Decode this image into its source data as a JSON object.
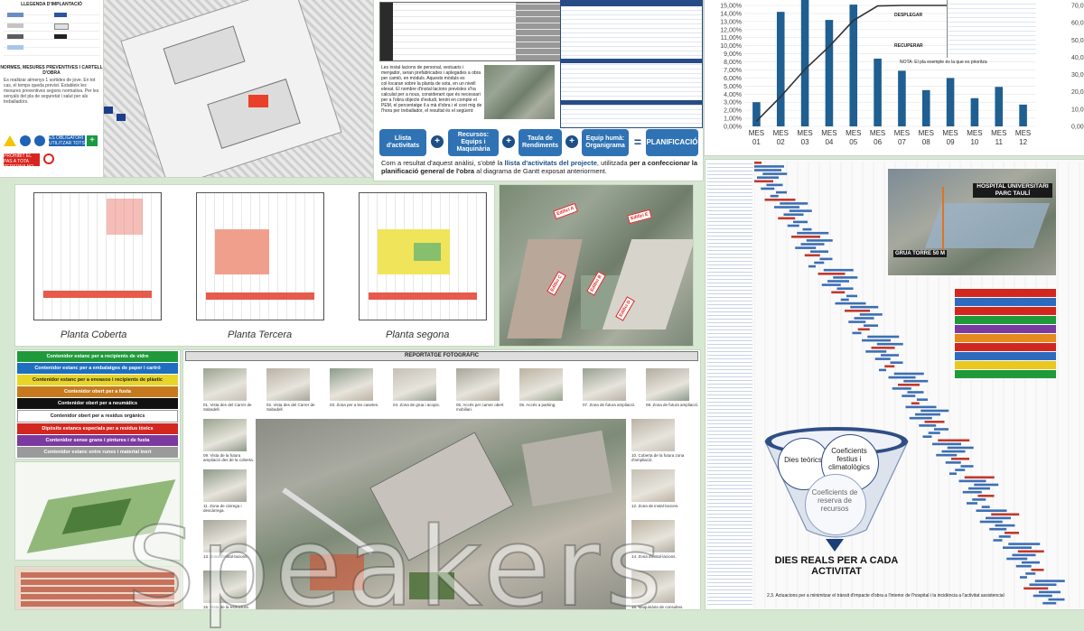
{
  "safety_panel": {
    "legend_title": "LLEGENDA D'IMPLANTACIÓ",
    "measures_title": "NORMES, MESURES PREVENTIVES I CARTELL D'OBRA",
    "body_text": "Es realitzar almenys 1 sortides de jove. En tot cas, el temps queda previst. Estableix les mesures preventives segons normativa. Per les senyals del pla de seguretat i salut per als treballadors.",
    "signs": [
      "ES OBLIGATORI UTILITZAR TOTS ELS EQUIPS DE PROTECCIÓ INDIVIDUAL",
      "PROHIBIT EL PAS A TOTA PERSONA NO AUTORITZADA"
    ]
  },
  "planning": {
    "text": "Les instal·lacions de personal, vestuaris i menjador, seran prefabricades i aplegades a obra per camió, en mòduls. Aquests mòduls es col·locaran sobre la planta de sota, en un nivell elevat. El nombre d'instal·lacions previstes s'ha calculat per a nous, considerant que és necessari per a l'obra objecte d'estudi, tenint en compte el PEM, el percentatge il a mà d'obra i el cost mig de l'hora per treballador, el resultat és el següent:",
    "flow": [
      {
        "label": "Llista d'activitats"
      },
      {
        "label": "Recursos: Equips i Maquinària"
      },
      {
        "label": "Taula de Rendiments"
      },
      {
        "label": "Equip humà: Organigrama"
      },
      {
        "label": "PLANIFICACIÓ"
      }
    ],
    "conclusion_start": "Com a resultat d'aquest anàlisi, s'obté la ",
    "conclusion_bold": "llista d'activitats del projecte",
    "conclusion_mid": ", utilitzada ",
    "conclusion_bold2": "per a confeccionar la planificació general de l'obra",
    "conclusion_end": " al diagrama de Gantt exposat anteriorment."
  },
  "plans": {
    "labels": [
      "Planta Coberta",
      "Planta Tercera",
      "Planta segona"
    ],
    "buildings": [
      "Edifici A",
      "Edifici B",
      "Edifici C",
      "Edifici D",
      "Edifici E"
    ]
  },
  "waste": {
    "rows": [
      {
        "label": "Contenidor estanc per a recipients de vidre",
        "color": "#1f9a3a"
      },
      {
        "label": "Contenidor estanc per a embalatges de paper i cartró",
        "color": "#1e6fc0"
      },
      {
        "label": "Contenidor estanc per a envasos i recipients de plàstic",
        "color": "#e9d52a"
      },
      {
        "label": "Contenidor obert per a fusta",
        "color": "#c77a1d"
      },
      {
        "label": "Contenidor obert per a neumàtics",
        "color": "#111111"
      },
      {
        "label": "Contenidor obert per a residus orgànics",
        "color": "#ffffff"
      },
      {
        "label": "Dipòsits estancs especials per a residus tòxics",
        "color": "#d2271f"
      },
      {
        "label": "Contenidor sense grans i pintures i de fusta",
        "color": "#7b3aa0"
      },
      {
        "label": "Contenidor estanc entre runes i material inert",
        "color": "#9a9a9a"
      }
    ]
  },
  "photo_report": {
    "title": "REPORTATGE FOTOGRÀFIC",
    "captions": [
      "01. Vista des del Carrer de Sabadell.",
      "02. Vista des del Carrer de Sabadell.",
      "03. Zona per a les casetes.",
      "04. Zona de grua i acopis.",
      "05. Accés per camer obert mobiliari.",
      "06. Accés a parking.",
      "07. Zona de futura ampliació.",
      "08. Zona de futura ampliació.",
      "09. Vista de la futura ampliació des de la coberta.",
      "10. Coberta de la futura zona d'ampliació.",
      "11. Zona de càrrega i descàrrega.",
      "12. Zona de instal·lacions.",
      "13. Zona d'instal·lacions.",
      "14. Zona d'instal·lacions.",
      "15. Vista de la estructura existent.",
      "16. Maquinària de consultes."
    ]
  },
  "chart": {
    "y_left_ticks": [
      "0,00%",
      "1,00%",
      "2,00%",
      "3,00%",
      "4,00%",
      "5,00%",
      "6,00%",
      "7,00%",
      "8,00%",
      "9,00%",
      "10,00%",
      "11,00%",
      "12,00%",
      "13,00%",
      "14,00%",
      "15,00%"
    ],
    "y_right_ticks": [
      "0,00%",
      "10,00%",
      "20,00%",
      "30,00%",
      "40,00%",
      "50,00%",
      "60,00%",
      "70,00%"
    ],
    "rec_labels": [
      "DESPLEGAR",
      "RECUPERAR"
    ],
    "legend_note": "NOTA: El pla exemple és la que es prioritza"
  },
  "chart_data": {
    "type": "bar",
    "categories": [
      "MES 01",
      "MES 02",
      "MES 03",
      "MES 04",
      "MES 05",
      "MES 06",
      "MES 07",
      "MES 08",
      "MES 09",
      "MES 10",
      "MES 11",
      "MES 12"
    ],
    "values": [
      3.0,
      14.2,
      15.8,
      13.2,
      15.1,
      8.4,
      6.9,
      4.5,
      6.0,
      3.5,
      4.9,
      2.7
    ],
    "cumulative": [
      3.0,
      17.2,
      33.0,
      46.2,
      61.3,
      69.7,
      76.6,
      81.1,
      87.1,
      90.6,
      95.5,
      98.2
    ],
    "ylim": [
      0,
      15
    ],
    "y2lim": [
      0,
      70
    ],
    "bar_color": "#1f5f91",
    "line_color": "#333333"
  },
  "gantt": {
    "hospital_label": "HOSPITAL UNIVERSITARI PARC TAULÍ",
    "crane_label": "GRUA TORRE 50 M",
    "funnel": [
      "Dies teòrics",
      "Coeficients festius i climatològics",
      "Coeficients de reserva de recursos"
    ],
    "result": "DIES REALS PER A CADA ACTIVITAT",
    "footer": "2.3. Actuacions per a minimitzar el trànsit d'impacte d'obra a l'interior de l'hospital i la incidència a l'activitat assistencial"
  },
  "watermark": "Speakers"
}
